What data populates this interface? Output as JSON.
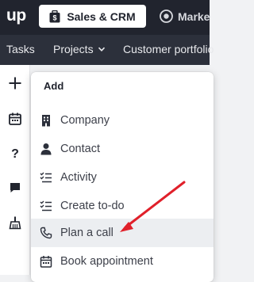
{
  "app": {
    "logo_text": "up",
    "product_active": "Sales & CRM",
    "product_other": "Marke"
  },
  "nav": {
    "tasks": "Tasks",
    "projects": "Projects",
    "customer": "Customer portfolio"
  },
  "menu": {
    "title": "Add",
    "items": [
      {
        "label": "Company",
        "icon": "building-icon"
      },
      {
        "label": "Contact",
        "icon": "person-icon"
      },
      {
        "label": "Activity",
        "icon": "checklist-icon"
      },
      {
        "label": "Create to-do",
        "icon": "checklist-icon"
      },
      {
        "label": "Plan a call",
        "icon": "phone-icon"
      },
      {
        "label": "Book appointment",
        "icon": "calendar-icon"
      }
    ],
    "hovered_item": "Plan a call"
  },
  "colors": {
    "topbar": "#21242e",
    "navbar": "#2c303b",
    "annotation_arrow": "#e0202a",
    "hover": "#eceef1"
  }
}
